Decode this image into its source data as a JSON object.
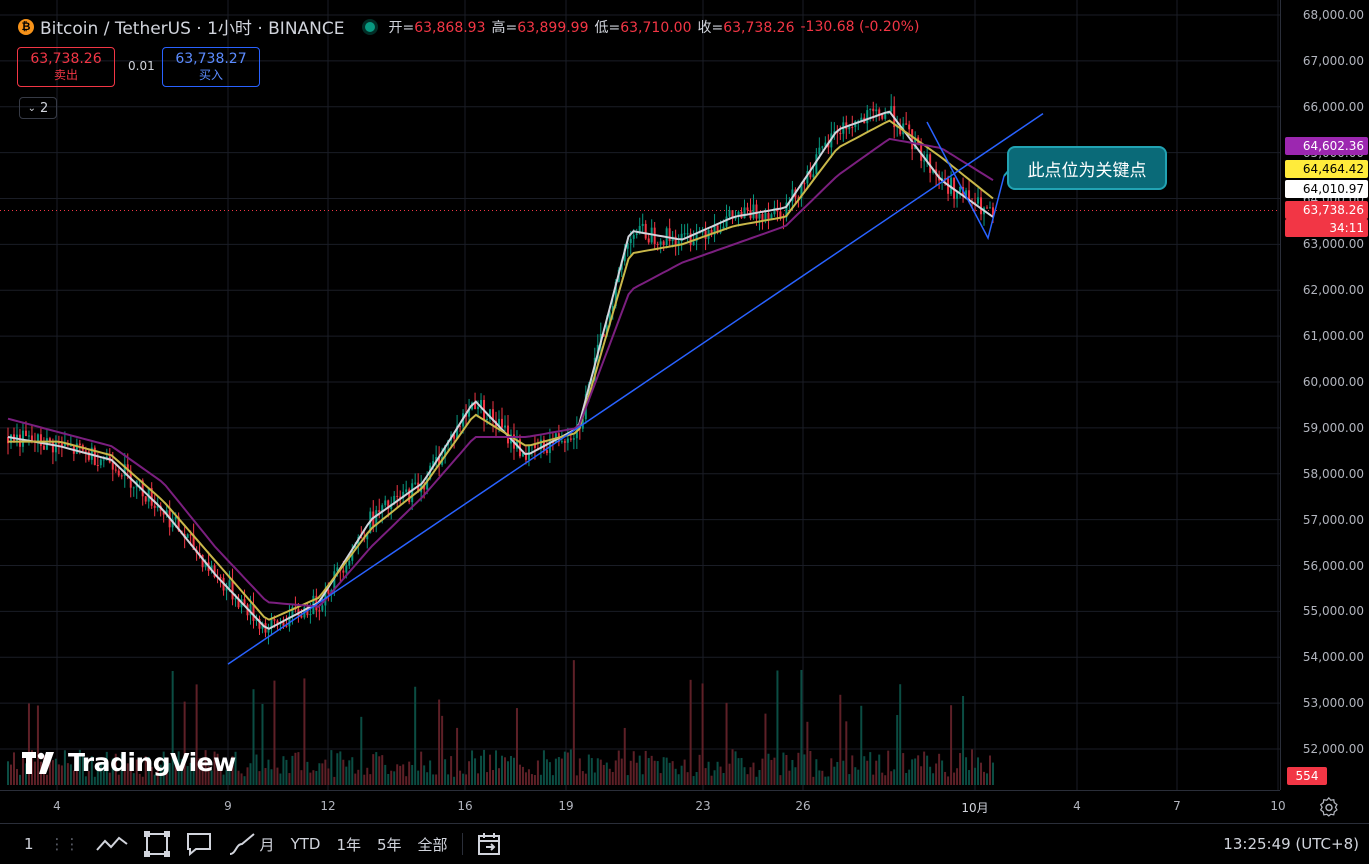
{
  "legend": {
    "symbol_icon": "bitcoin-icon",
    "title": "Bitcoin / TetherUS · 1小时 · BINANCE",
    "open_label": "开=",
    "open": "63,868.93",
    "high_label": "高=",
    "high": "63,899.99",
    "low_label": "低=",
    "low": "63,710.00",
    "close_label": "收=",
    "close": "63,738.26",
    "change": "-130.68 (-0.20%)"
  },
  "trade": {
    "sell_price": "63,738.26",
    "sell_label": "卖出",
    "spread": "0.01",
    "buy_price": "63,738.27",
    "buy_label": "买入"
  },
  "indicators_toggle": "2",
  "watermark": "TradingView",
  "annotation": "此点位为关键点",
  "price_axis": {
    "ticks": [
      "68,000.00",
      "67,000.00",
      "66,000.00",
      "65,000.00",
      "64,000.00",
      "63,000.00",
      "62,000.00",
      "61,000.00",
      "60,000.00",
      "59,000.00",
      "58,000.00",
      "57,000.00",
      "56,000.00",
      "55,000.00",
      "54,000.00",
      "53,000.00",
      "52,000.00"
    ],
    "tick_values": [
      68000,
      67000,
      66000,
      65000,
      64000,
      63000,
      62000,
      61000,
      60000,
      59000,
      58000,
      57000,
      56000,
      55000,
      54000,
      53000,
      52000
    ],
    "labels": [
      {
        "text": "64,602.36",
        "bg": "#9c27b0",
        "color": "#ffffff"
      },
      {
        "text": "64,464.42",
        "bg": "#ffeb3b",
        "color": "#000000"
      },
      {
        "text": "64,010.97",
        "bg": "#ffffff",
        "color": "#000000"
      },
      {
        "text": "63,738.26",
        "bg": "#f23645",
        "color": "#ffffff"
      },
      {
        "text": "34:11",
        "bg": "#f23645",
        "color": "#ffffff"
      }
    ],
    "volume_label": "554"
  },
  "time_axis": {
    "ticks": [
      "4",
      "9",
      "12",
      "16",
      "19",
      "23",
      "26",
      "10月",
      "4",
      "7",
      "10"
    ]
  },
  "bottom_bar": {
    "items": [
      "1",
      "月",
      "YTD",
      "1年",
      "5年",
      "全部"
    ],
    "clock": "13:25:49 (UTC+8)"
  },
  "colors": {
    "up": "#089981",
    "down": "#f23645",
    "ma_fast": "#d1d4dc",
    "ma_mid": "#c9b84a",
    "ma_slow": "#7b1f7f",
    "trendline": "#2962ff"
  },
  "chart_data": {
    "type": "line",
    "title": "Bitcoin / TetherUS · 1小时 · BINANCE",
    "xlabel": "",
    "ylabel": "",
    "ylim": [
      51500,
      68300
    ],
    "x": [
      "4",
      "9",
      "12",
      "16",
      "19",
      "23",
      "26",
      "10月"
    ],
    "series": [
      {
        "values": [
          58800,
          58600,
          58300,
          57200,
          55800,
          54600,
          55200,
          57000,
          57800,
          59600,
          58400,
          59000,
          63300,
          63100,
          63600,
          63800,
          65500,
          65900,
          64400,
          63600
        ]
      },
      {
        "values": [
          58700,
          58700,
          58400,
          57400,
          56100,
          54800,
          55300,
          56800,
          57700,
          59300,
          58600,
          58900,
          62800,
          63000,
          63400,
          63600,
          65100,
          65700,
          64900,
          64000
        ]
      },
      {
        "values": [
          59200,
          58900,
          58600,
          57800,
          56400,
          55200,
          55100,
          56400,
          57500,
          58800,
          58800,
          59000,
          62000,
          62600,
          63000,
          63400,
          64500,
          65300,
          65100,
          64400
        ]
      }
    ],
    "annotation": "此点位为关键点",
    "close": 63738.26
  }
}
